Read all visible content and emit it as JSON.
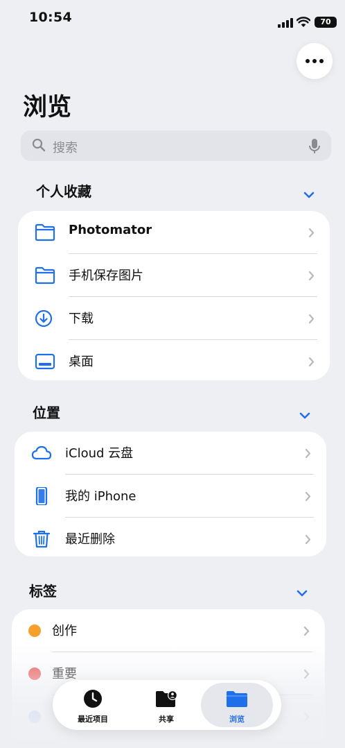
{
  "status_bar": {
    "time": "10:54",
    "battery": "70"
  },
  "page_title": "浏览",
  "search": {
    "placeholder": "搜索"
  },
  "sections": {
    "favorites": {
      "title": "个人收藏",
      "items": [
        {
          "label": "Photomator",
          "icon": "folder-icon"
        },
        {
          "label": "手机保存图片",
          "icon": "folder-icon"
        },
        {
          "label": "下载",
          "icon": "download-icon"
        },
        {
          "label": "桌面",
          "icon": "desktop-icon"
        }
      ]
    },
    "locations": {
      "title": "位置",
      "items": [
        {
          "label": "iCloud 云盘",
          "icon": "cloud-icon"
        },
        {
          "label": "我的 iPhone",
          "icon": "iphone-icon"
        },
        {
          "label": "最近删除",
          "icon": "trash-icon"
        }
      ]
    },
    "tags": {
      "title": "标签",
      "items": [
        {
          "label": "创作",
          "color": "#f5a02a"
        },
        {
          "label": "重要",
          "color": "#ee4f4f"
        }
      ]
    }
  },
  "tab_bar": {
    "tabs": [
      {
        "label": "最近项目",
        "icon": "clock-icon"
      },
      {
        "label": "共享",
        "icon": "shared-folder-icon"
      },
      {
        "label": "浏览",
        "icon": "folder-icon",
        "selected": true
      }
    ]
  },
  "colors": {
    "accent": "#1f6feb",
    "background": "#eeeff3"
  }
}
